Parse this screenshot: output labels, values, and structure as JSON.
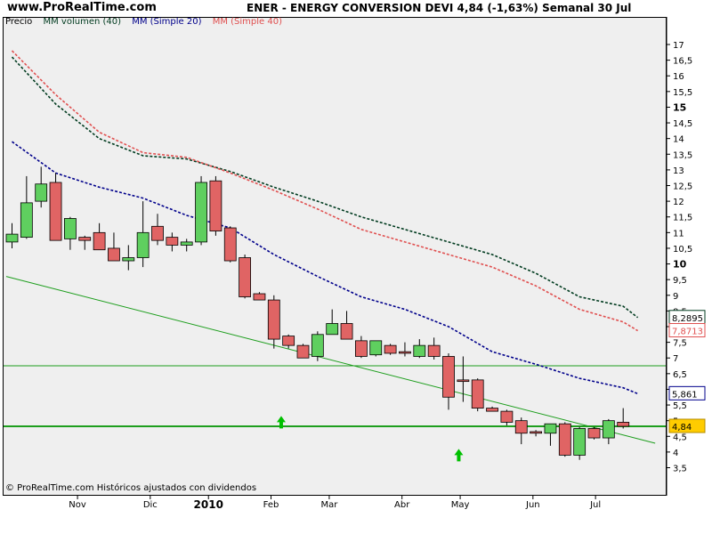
{
  "header": {
    "site": "www.ProRealTime.com",
    "title": "ENER - ENERGY CONVERSION DEVI    4,84 (-1,63%)    Semanal  30 Jul"
  },
  "legend": {
    "price": "Precio",
    "vol": "MM volumen (40)",
    "sma20": "MM (Simple 20)",
    "sma40": "MM (Simple 40)"
  },
  "footer": {
    "copyright": "© ProRealTime.com  Históricos ajustados con dividendos"
  },
  "colors": {
    "up": "#5fcf5f",
    "down": "#e06464",
    "sma20": "#00008b",
    "sma40": "#e05050",
    "vol": "#003b1f",
    "trend": "#1e9e1e",
    "bg": "#efefef"
  },
  "chart_data": {
    "type": "candlestick",
    "title": "ENER - ENERGY CONVERSION DEVI",
    "ylim": [
      3.2,
      17.5
    ],
    "y_ticks": [
      "17",
      "16,5",
      "16",
      "15,5",
      "15",
      "14,5",
      "14",
      "13,5",
      "13",
      "12,5",
      "12",
      "11,5",
      "11",
      "10,5",
      "10",
      "9,5",
      "9",
      "8,5",
      "8",
      "7,5",
      "7",
      "6,5",
      "6",
      "5,5",
      "5",
      "4,5",
      "4",
      "3,5"
    ],
    "y_tick_values": [
      17,
      16.5,
      16,
      15.5,
      15,
      14.5,
      14,
      13.5,
      13,
      12.5,
      12,
      11.5,
      11,
      10.5,
      10,
      9.5,
      9,
      8.5,
      8,
      7.5,
      7,
      6.5,
      6,
      5.5,
      5,
      4.5,
      4,
      3.5
    ],
    "y_bold": [
      15,
      10
    ],
    "x_labels": [
      {
        "label": "Nov",
        "week": 4.5,
        "bold": false
      },
      {
        "label": "Dic",
        "week": 9.5,
        "bold": false
      },
      {
        "label": "2010",
        "week": 13.5,
        "bold": true
      },
      {
        "label": "Feb",
        "week": 17.8,
        "bold": false
      },
      {
        "label": "Mar",
        "week": 21.8,
        "bold": false
      },
      {
        "label": "Abr",
        "week": 26.8,
        "bold": false
      },
      {
        "label": "May",
        "week": 30.8,
        "bold": false
      },
      {
        "label": "Jun",
        "week": 35.8,
        "bold": false
      },
      {
        "label": "Jul",
        "week": 40.1,
        "bold": false
      }
    ],
    "candles": [
      {
        "o": 10.7,
        "h": 11.3,
        "l": 10.5,
        "c": 10.95
      },
      {
        "o": 10.85,
        "h": 12.8,
        "l": 10.8,
        "c": 11.95
      },
      {
        "o": 12.0,
        "h": 13.1,
        "l": 11.8,
        "c": 12.55
      },
      {
        "o": 12.6,
        "h": 12.9,
        "l": 10.8,
        "c": 10.75
      },
      {
        "o": 10.8,
        "h": 11.5,
        "l": 10.45,
        "c": 11.45
      },
      {
        "o": 10.85,
        "h": 10.9,
        "l": 10.45,
        "c": 10.75
      },
      {
        "o": 11.0,
        "h": 11.3,
        "l": 10.5,
        "c": 10.45
      },
      {
        "o": 10.5,
        "h": 11.0,
        "l": 10.2,
        "c": 10.1
      },
      {
        "o": 10.1,
        "h": 10.6,
        "l": 9.8,
        "c": 10.2
      },
      {
        "o": 10.2,
        "h": 12.0,
        "l": 9.9,
        "c": 11.0
      },
      {
        "o": 11.2,
        "h": 11.6,
        "l": 10.6,
        "c": 10.75
      },
      {
        "o": 10.85,
        "h": 11.0,
        "l": 10.4,
        "c": 10.6
      },
      {
        "o": 10.6,
        "h": 10.8,
        "l": 10.4,
        "c": 10.7
      },
      {
        "o": 10.7,
        "h": 12.8,
        "l": 10.6,
        "c": 12.6
      },
      {
        "o": 12.65,
        "h": 12.8,
        "l": 10.9,
        "c": 11.05
      },
      {
        "o": 11.15,
        "h": 11.2,
        "l": 10.05,
        "c": 10.1
      },
      {
        "o": 10.2,
        "h": 10.3,
        "l": 8.9,
        "c": 8.95
      },
      {
        "o": 9.05,
        "h": 9.1,
        "l": 8.9,
        "c": 8.85
      },
      {
        "o": 8.85,
        "h": 9.0,
        "l": 7.3,
        "c": 7.6
      },
      {
        "o": 7.7,
        "h": 7.75,
        "l": 7.3,
        "c": 7.4
      },
      {
        "o": 7.4,
        "h": 7.45,
        "l": 7.0,
        "c": 7.0
      },
      {
        "o": 7.05,
        "h": 7.85,
        "l": 6.9,
        "c": 7.75
      },
      {
        "o": 7.75,
        "h": 8.55,
        "l": 7.8,
        "c": 8.1
      },
      {
        "o": 8.1,
        "h": 8.5,
        "l": 7.6,
        "c": 7.6
      },
      {
        "o": 7.55,
        "h": 7.7,
        "l": 7.0,
        "c": 7.05
      },
      {
        "o": 7.1,
        "h": 7.5,
        "l": 7.05,
        "c": 7.55
      },
      {
        "o": 7.4,
        "h": 7.45,
        "l": 7.1,
        "c": 7.15
      },
      {
        "o": 7.2,
        "h": 7.5,
        "l": 7.05,
        "c": 7.15
      },
      {
        "o": 7.05,
        "h": 7.6,
        "l": 7.0,
        "c": 7.4
      },
      {
        "o": 7.4,
        "h": 7.65,
        "l": 6.95,
        "c": 7.05
      },
      {
        "o": 7.05,
        "h": 7.15,
        "l": 5.35,
        "c": 5.75
      },
      {
        "o": 6.3,
        "h": 7.05,
        "l": 5.6,
        "c": 6.25
      },
      {
        "o": 6.3,
        "h": 6.35,
        "l": 5.3,
        "c": 5.4
      },
      {
        "o": 5.4,
        "h": 5.45,
        "l": 5.3,
        "c": 5.3
      },
      {
        "o": 5.3,
        "h": 5.35,
        "l": 4.85,
        "c": 4.95
      },
      {
        "o": 5.0,
        "h": 5.1,
        "l": 4.25,
        "c": 4.6
      },
      {
        "o": 4.65,
        "h": 4.7,
        "l": 4.5,
        "c": 4.6
      },
      {
        "o": 4.6,
        "h": 4.9,
        "l": 4.2,
        "c": 4.9
      },
      {
        "o": 4.9,
        "h": 4.95,
        "l": 3.85,
        "c": 3.9
      },
      {
        "o": 3.9,
        "h": 4.8,
        "l": 3.75,
        "c": 4.75
      },
      {
        "o": 4.75,
        "h": 4.8,
        "l": 4.4,
        "c": 4.45
      },
      {
        "o": 4.45,
        "h": 5.05,
        "l": 4.25,
        "c": 5.0
      },
      {
        "o": 4.95,
        "h": 5.4,
        "l": 4.75,
        "c": 4.82
      }
    ],
    "sma20": {
      "name": "MM (Simple 20)",
      "points": [
        [
          0,
          13.9
        ],
        [
          3,
          12.9
        ],
        [
          6,
          12.45
        ],
        [
          9,
          12.1
        ],
        [
          12,
          11.55
        ],
        [
          15,
          11.15
        ],
        [
          18,
          10.3
        ],
        [
          21,
          9.6
        ],
        [
          24,
          8.95
        ],
        [
          27,
          8.55
        ],
        [
          30,
          8.0
        ],
        [
          33,
          7.2
        ],
        [
          36,
          6.8
        ],
        [
          39,
          6.35
        ],
        [
          42,
          6.05
        ],
        [
          43,
          5.86
        ]
      ],
      "last": "5,861"
    },
    "sma40": {
      "name": "MM (Simple 40)",
      "points": [
        [
          0,
          16.8
        ],
        [
          3,
          15.4
        ],
        [
          6,
          14.2
        ],
        [
          9,
          13.55
        ],
        [
          12,
          13.4
        ],
        [
          15,
          12.9
        ],
        [
          18,
          12.35
        ],
        [
          21,
          11.75
        ],
        [
          24,
          11.1
        ],
        [
          27,
          10.7
        ],
        [
          30,
          10.3
        ],
        [
          33,
          9.9
        ],
        [
          36,
          9.3
        ],
        [
          39,
          8.55
        ],
        [
          42,
          8.15
        ],
        [
          43,
          7.87
        ]
      ],
      "last": "7,8713"
    },
    "mmvol": {
      "name": "MM volumen (40)",
      "points": [
        [
          0,
          16.6
        ],
        [
          3,
          15.1
        ],
        [
          6,
          14.0
        ],
        [
          9,
          13.45
        ],
        [
          12,
          13.35
        ],
        [
          15,
          12.95
        ],
        [
          18,
          12.45
        ],
        [
          21,
          12.0
        ],
        [
          24,
          11.5
        ],
        [
          27,
          11.1
        ],
        [
          30,
          10.7
        ],
        [
          33,
          10.3
        ],
        [
          36,
          9.7
        ],
        [
          39,
          8.95
        ],
        [
          42,
          8.65
        ],
        [
          43,
          8.29
        ]
      ],
      "last": "8,2895"
    },
    "trendline": {
      "from": [
        -0.4,
        9.6
      ],
      "to": [
        44.2,
        4.28
      ]
    },
    "hlines": [
      6.75,
      4.82
    ],
    "arrows_up": [
      {
        "week": 18.5,
        "value": 4.95
      },
      {
        "week": 30.7,
        "value": 3.9
      }
    ],
    "current_price": "4,84"
  }
}
